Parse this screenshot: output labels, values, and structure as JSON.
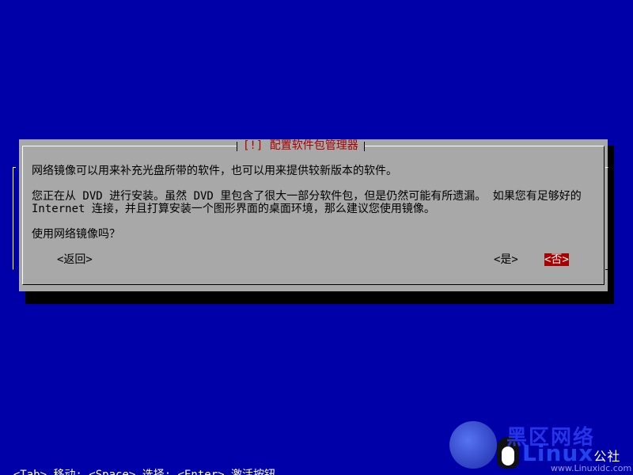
{
  "dialog": {
    "title": "[!] 配置软件包管理器",
    "paragraph1": "网络镜像可以用来补充光盘所带的软件，也可以用来提供较新版本的软件。",
    "paragraph2": "您正在从 DVD 进行安装。虽然 DVD 里包含了很大一部分软件包，但是仍然可能有所遗漏。 如果您有足够好的 Internet 连接，并且打算安装一个图形界面的桌面环境，那么建议您使用镜像。",
    "question": "使用网络镜像吗？",
    "buttons": {
      "back": "<返回>",
      "yes": "<是>",
      "no": "<否>"
    },
    "selected_button": "no"
  },
  "statusbar": {
    "text": "<Tab> 移动; <Space> 选择; <Enter> 激活按钮"
  },
  "watermark": {
    "top_text": "黑区网络",
    "brand": "Linux",
    "suffix": "公社",
    "url": "www.Linuxidc.com"
  },
  "colors": {
    "background": "#0000a8",
    "dialog": "#a8a8a8",
    "title": "#a80000",
    "selected_button_bg": "#a80000",
    "selected_button_fg": "#ffffff"
  }
}
